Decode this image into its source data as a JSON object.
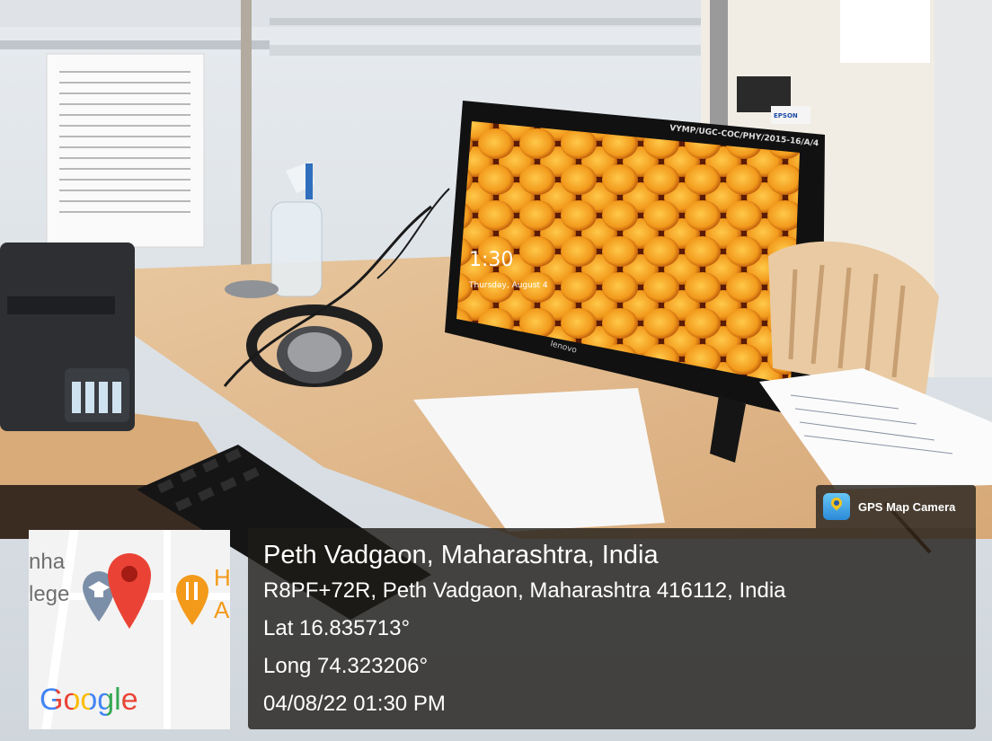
{
  "photo": {
    "monitor_label": "VYMP/UGC-COC/PHY/2015-16/A/4",
    "screen_time": "1:30",
    "screen_date": "Thursday, August 4",
    "brand": "lenovo",
    "printer_brand": "EPSON"
  },
  "overlay": {
    "app_badge": "GPS Map Camera",
    "map": {
      "brand": "Google",
      "partial_left_1": "nha",
      "partial_left_2": "lege",
      "partial_right_1": "H",
      "partial_right_2": "A"
    },
    "place": "Peth Vadgaon, Maharashtra, India",
    "address": "R8PF+72R, Peth Vadgaon, Maharashtra 416112, India",
    "lat": "Lat 16.835713°",
    "long": "Long 74.323206°",
    "datetime": "04/08/22 01:30 PM"
  },
  "colors": {
    "google_blue": "#4285F4",
    "google_red": "#EA4335",
    "google_yellow": "#FBBC05",
    "google_green": "#34A853",
    "screen_orange": "#e8921c"
  }
}
